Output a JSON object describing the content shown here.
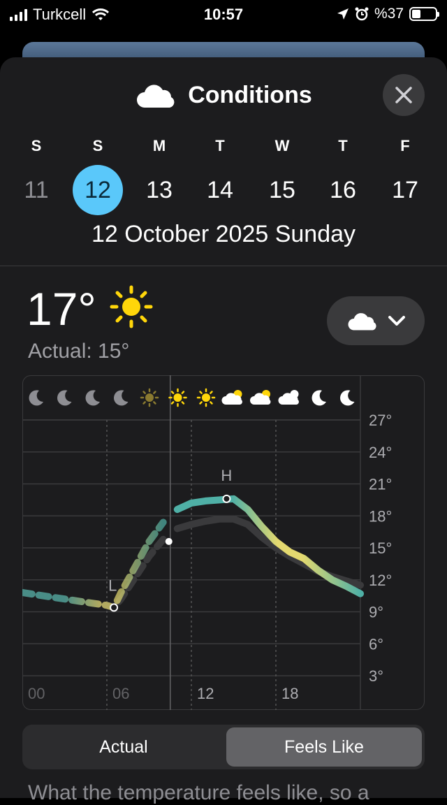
{
  "status_bar": {
    "carrier": "Turkcell",
    "time": "10:57",
    "battery": "%37"
  },
  "header": {
    "title": "Conditions",
    "icon": "cloud-icon",
    "close": "close-icon"
  },
  "week": {
    "days": [
      {
        "letter": "S",
        "num": "11",
        "dim": true
      },
      {
        "letter": "S",
        "num": "12",
        "selected": true
      },
      {
        "letter": "M",
        "num": "13"
      },
      {
        "letter": "T",
        "num": "14"
      },
      {
        "letter": "W",
        "num": "15"
      },
      {
        "letter": "T",
        "num": "16"
      },
      {
        "letter": "F",
        "num": "17"
      }
    ],
    "selected_date": "12 October 2025 Sunday"
  },
  "current": {
    "temp": "17°",
    "icon": "sun-icon",
    "actual": "Actual: 15°"
  },
  "mode_selector": {
    "icon": "cloud-icon",
    "chevron": "chevron-down-icon"
  },
  "chart_data": {
    "type": "line",
    "x_ticks": [
      "00",
      "06",
      "12",
      "18"
    ],
    "y_ticks": [
      "27°",
      "24°",
      "21°",
      "18°",
      "15°",
      "12°",
      "9°",
      "6°",
      "3°"
    ],
    "ylim": [
      3,
      27
    ],
    "annotations": [
      {
        "label": "L",
        "x": 6.5,
        "y": 9.4
      },
      {
        "label": "H",
        "x": 14.5,
        "y": 19.6
      }
    ],
    "hour_icons": [
      "moon-icon",
      "moon-icon",
      "moon-icon",
      "moon-icon",
      "sun-icon",
      "sun-icon",
      "sun-icon",
      "partly-cloudy-day-icon",
      "partly-cloudy-day-icon",
      "partly-cloudy-night-icon",
      "moon-icon",
      "moon-icon"
    ],
    "series": [
      {
        "name": "Feels Like",
        "x": [
          0,
          1,
          2,
          3,
          4,
          5,
          6,
          6.5,
          7,
          8,
          9,
          10,
          11,
          12,
          13,
          14,
          15,
          16,
          17,
          18,
          19,
          20,
          21,
          22,
          23,
          24
        ],
        "y": [
          10.8,
          10.6,
          10.4,
          10.2,
          10.0,
          9.8,
          9.6,
          9.4,
          10.8,
          13.2,
          15.6,
          17.4,
          18.6,
          19.2,
          19.4,
          19.5,
          19.6,
          18.6,
          17.0,
          15.6,
          14.6,
          14.0,
          12.9,
          12.0,
          11.4,
          10.7
        ]
      },
      {
        "name": "Actual",
        "x": [
          0,
          1,
          2,
          3,
          4,
          5,
          6,
          6.5,
          7,
          8,
          9,
          10,
          11,
          12,
          13,
          14,
          15,
          16,
          17,
          18,
          19,
          20,
          21,
          22,
          23,
          24
        ],
        "y": [
          10.8,
          10.6,
          10.4,
          10.2,
          10.0,
          9.8,
          9.6,
          9.4,
          10.2,
          12.2,
          14.2,
          15.8,
          16.8,
          17.2,
          17.5,
          17.7,
          17.7,
          17.2,
          16.0,
          15.0,
          14.2,
          13.5,
          12.8,
          12.3,
          11.9,
          11.5
        ]
      }
    ],
    "now_hour": 10.5,
    "colors": {
      "cold": "#4fb0a6",
      "warm": "#e4d96f",
      "actual": "#3a3a3c",
      "grid": "#3a3a3c"
    }
  },
  "toggle": {
    "actual": "Actual",
    "feels_like": "Feels Like",
    "selected": "Feels Like"
  },
  "description": "What the temperature feels like, so a"
}
